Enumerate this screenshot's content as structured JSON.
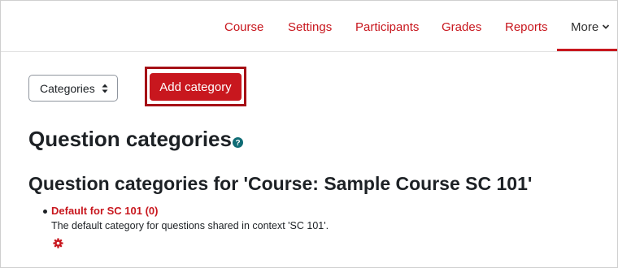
{
  "nav": {
    "items": [
      {
        "label": "Course"
      },
      {
        "label": "Settings"
      },
      {
        "label": "Participants"
      },
      {
        "label": "Grades"
      },
      {
        "label": "Reports"
      }
    ],
    "more_label": "More"
  },
  "toolbar": {
    "select_value": "Categories",
    "add_button_label": "Add category"
  },
  "page": {
    "title": "Question categories",
    "context_heading": "Question categories for 'Course: Sample Course SC 101'"
  },
  "categories": [
    {
      "name": "Default for SC 101 (0)",
      "description": "The default category for questions shared in context 'SC 101'."
    }
  ],
  "colors": {
    "accent": "#c8171e",
    "highlight_border": "#a51016",
    "text": "#1d2125"
  },
  "icons": {
    "help": "question-circle-icon",
    "edit": "gear-icon",
    "sort": "sort-icon",
    "more": "chevron-down-icon"
  }
}
